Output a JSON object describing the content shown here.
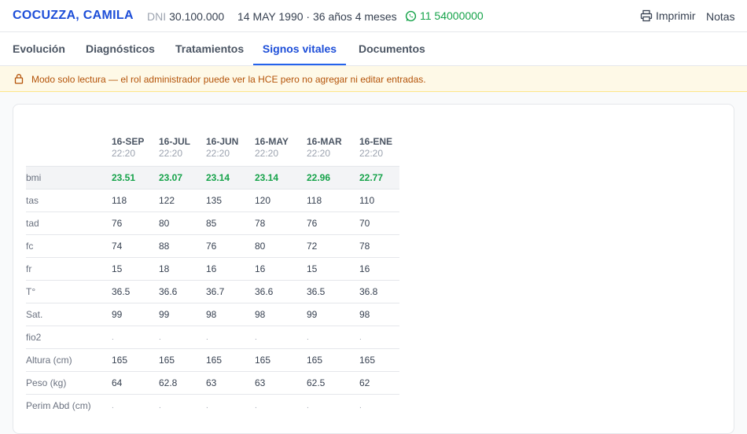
{
  "header": {
    "patient_name": "COCUZZA, CAMILA",
    "dni_label": "DNI",
    "dni_value": "30.100.000",
    "dob": "14 MAY 1990 · 36 años 4 meses",
    "phone": "11 54000000",
    "print_label": "Imprimir",
    "notes_label": "Notas"
  },
  "tabs": [
    {
      "label": "Evolución"
    },
    {
      "label": "Diagnósticos"
    },
    {
      "label": "Tratamientos"
    },
    {
      "label": "Signos vitales",
      "active": true
    },
    {
      "label": "Documentos"
    }
  ],
  "banner": {
    "icon": "lock-icon",
    "text": "Modo solo lectura — el rol administrador puede ver la HCE pero no agregar ni editar entradas."
  },
  "vitals": {
    "columns": [
      {
        "date": "16-SEP",
        "time": "22:20"
      },
      {
        "date": "16-JUL",
        "time": "22:20"
      },
      {
        "date": "16-JUN",
        "time": "22:20"
      },
      {
        "date": "16-MAY",
        "time": "22:20"
      },
      {
        "date": "16-MAR",
        "time": "22:20"
      },
      {
        "date": "16-ENE",
        "time": "22:20"
      }
    ],
    "rows": [
      {
        "label": "bmi",
        "values": [
          "23.51",
          "23.07",
          "23.14",
          "23.14",
          "22.96",
          "22.77"
        ]
      },
      {
        "label": "tas",
        "values": [
          "118",
          "122",
          "135",
          "120",
          "118",
          "110"
        ]
      },
      {
        "label": "tad",
        "values": [
          "76",
          "80",
          "85",
          "78",
          "76",
          "70"
        ]
      },
      {
        "label": "fc",
        "values": [
          "74",
          "88",
          "76",
          "80",
          "72",
          "78"
        ]
      },
      {
        "label": "fr",
        "values": [
          "15",
          "18",
          "16",
          "16",
          "15",
          "16"
        ]
      },
      {
        "label": "T°",
        "values": [
          "36.5",
          "36.6",
          "36.7",
          "36.6",
          "36.5",
          "36.8"
        ]
      },
      {
        "label": "Sat.",
        "values": [
          "99",
          "99",
          "98",
          "98",
          "99",
          "98"
        ]
      },
      {
        "label": "fio2",
        "values": [
          ".",
          ".",
          ".",
          ".",
          ".",
          "."
        ]
      },
      {
        "label": "Altura (cm)",
        "values": [
          "165",
          "165",
          "165",
          "165",
          "165",
          "165"
        ]
      },
      {
        "label": "Peso (kg)",
        "values": [
          "64",
          "62.8",
          "63",
          "63",
          "62.5",
          "62"
        ]
      },
      {
        "label": "Perim Abd (cm)",
        "values": [
          ".",
          ".",
          ".",
          ".",
          ".",
          "."
        ]
      }
    ]
  },
  "colors": {
    "brand": "#1d4ed8",
    "bmi_value": "#16a34a",
    "banner_text": "#b45309",
    "banner_bg": "#fef9e7"
  }
}
